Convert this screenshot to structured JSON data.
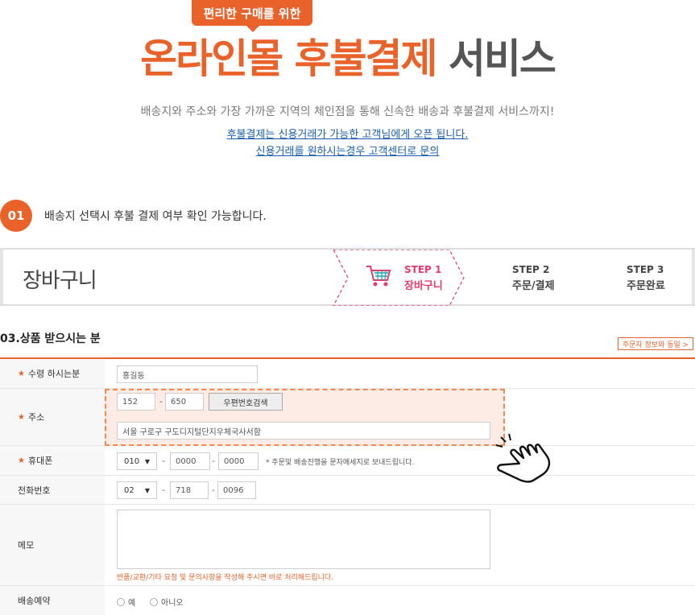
{
  "header": {
    "badge": "편리한 구매를 위한",
    "title_orange": "온라인몰 후불결제",
    "title_gray": "서비스",
    "description": "배송지와 주소와 가장 가까운 지역의 체인점을 통해 신속한 배송과 후불결제 서비스까지!",
    "link1": "후불결제는 신용거래가 가능한 고객님에게 오픈 됩니다.",
    "link2": "신용거래를 원하시는경우 고객센터로 문의"
  },
  "step_intro": {
    "number": "01",
    "text": "배송지 선택시 후불 결제 여부 확인 가능합니다."
  },
  "cart_bar": {
    "title": "장바구니",
    "steps": [
      {
        "no": "STEP 1",
        "label": "장바구니",
        "active": true
      },
      {
        "no": "STEP 2",
        "label": "주문/결제",
        "active": false
      },
      {
        "no": "STEP 3",
        "label": "주문완료",
        "active": false
      }
    ]
  },
  "section": {
    "title": "03.상품 받으시는 분",
    "same_button": "주문자 정보와 동일 >"
  },
  "form": {
    "recipient": {
      "label": "수령 하시는분",
      "value": "홍길동"
    },
    "address": {
      "label": "주소",
      "zip1": "152",
      "zip2": "650",
      "zip_button": "우편번호검색",
      "address_value": "서울 구로구 구도디지털단지우체국사서함"
    },
    "mobile": {
      "label": "휴대폰",
      "prefix": "010",
      "mid": "0000",
      "last": "0000",
      "note": "* 주문및 배송진행을 문자메세지로 보내드립니다."
    },
    "phone": {
      "label": "전화번호",
      "prefix": "02",
      "mid": "718",
      "last": "0096"
    },
    "memo": {
      "label": "메모",
      "note": "반품/교환/기타 요청 및 문의사항을 작성해 주시면 바로 처리해드립니다."
    },
    "delivery": {
      "label": "배송예약",
      "option_yes": "예",
      "option_no": "아니오"
    }
  },
  "colors": {
    "accent": "#e9622a",
    "step_active": "#e83a6a",
    "link": "#1a5fb0"
  }
}
